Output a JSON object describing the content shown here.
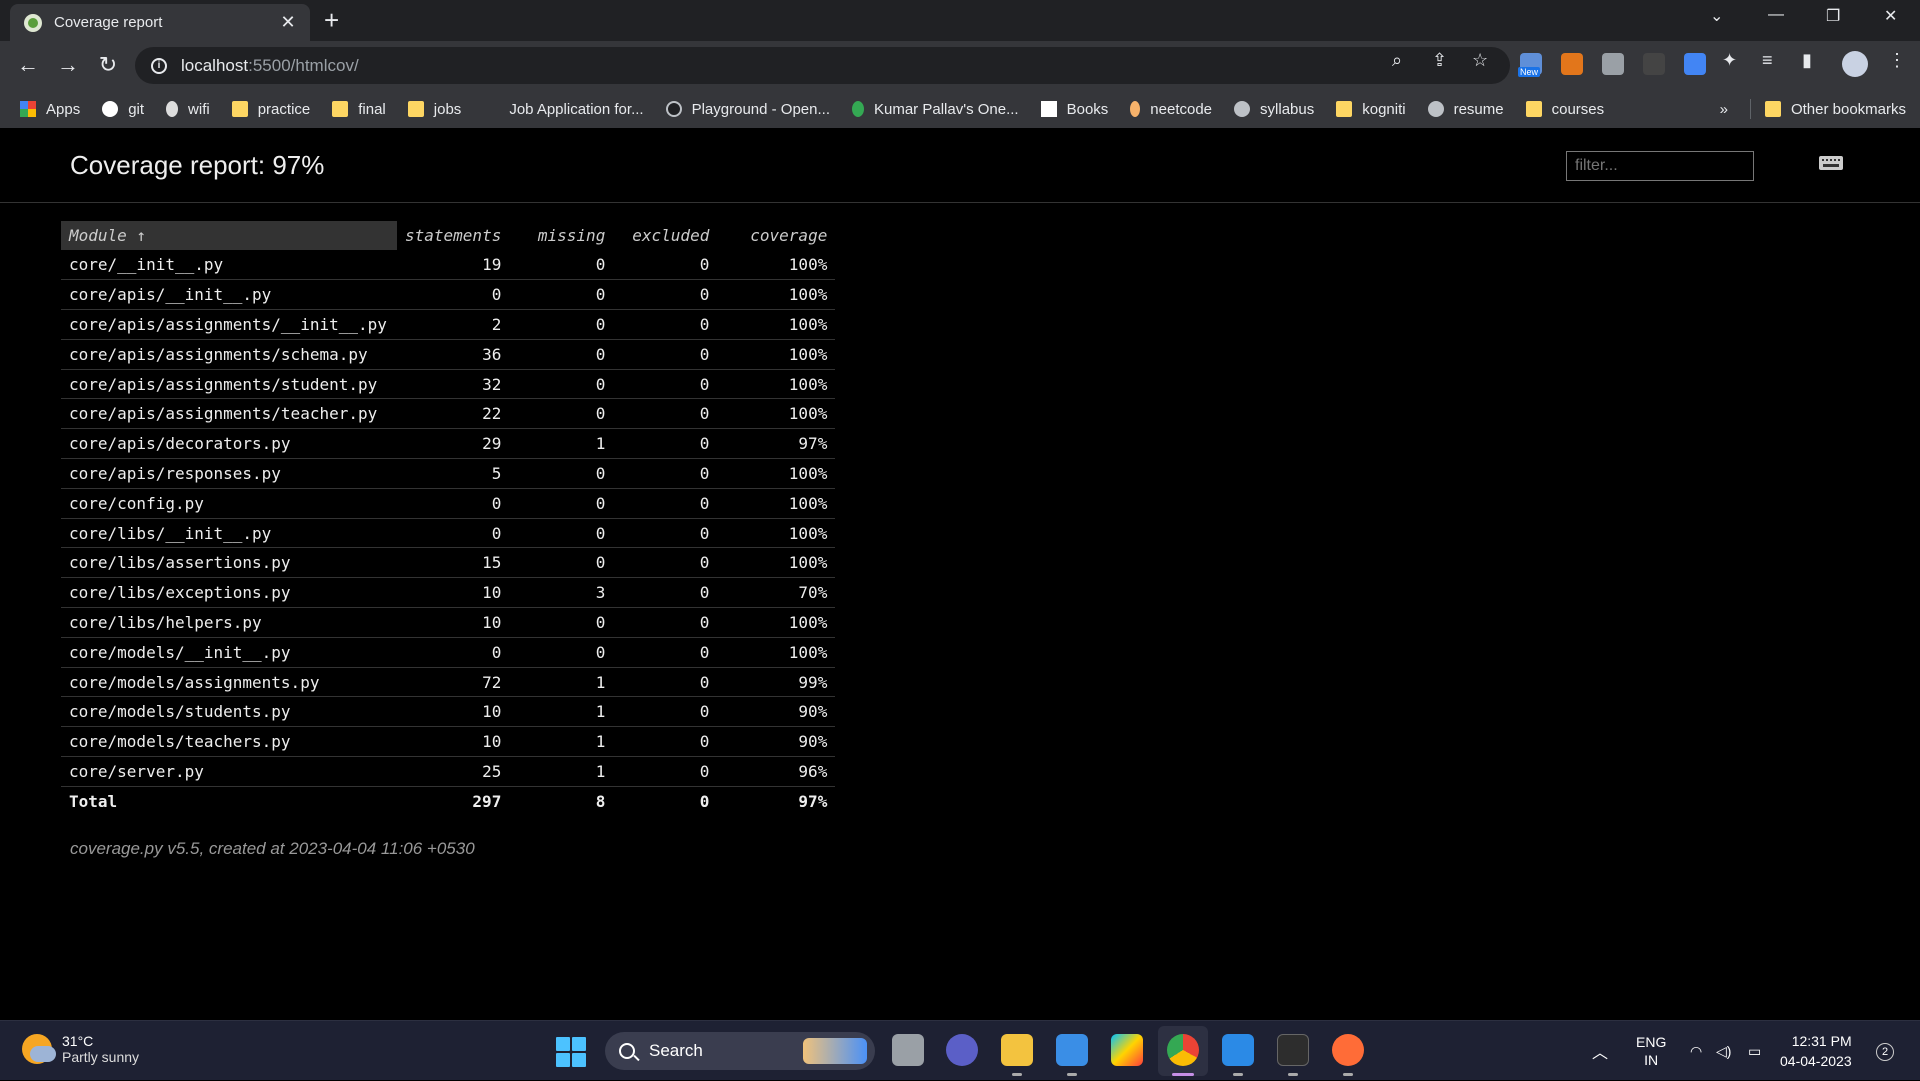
{
  "browser": {
    "tab_title": "Coverage report",
    "url_host": "localhost",
    "url_path": ":5500/htmlcov/",
    "bookmarks": [
      "Apps",
      "git",
      "wifi",
      "practice",
      "final",
      "jobs",
      "Job Application for...",
      "Playground - Open...",
      "Kumar Pallav's One...",
      "Books",
      "neetcode",
      "syllabus",
      "kogniti",
      "resume",
      "courses"
    ],
    "bookmarks_overflow": "»",
    "other_bookmarks": "Other bookmarks",
    "ext_new_badge": "New"
  },
  "report": {
    "title": "Coverage report: 97%",
    "filter_placeholder": "filter...",
    "columns": [
      "Module ↑",
      "statements",
      "missing",
      "excluded",
      "coverage"
    ],
    "rows": [
      [
        "core/__init__.py",
        "19",
        "0",
        "0",
        "100%"
      ],
      [
        "core/apis/__init__.py",
        "0",
        "0",
        "0",
        "100%"
      ],
      [
        "core/apis/assignments/__init__.py",
        "2",
        "0",
        "0",
        "100%"
      ],
      [
        "core/apis/assignments/schema.py",
        "36",
        "0",
        "0",
        "100%"
      ],
      [
        "core/apis/assignments/student.py",
        "32",
        "0",
        "0",
        "100%"
      ],
      [
        "core/apis/assignments/teacher.py",
        "22",
        "0",
        "0",
        "100%"
      ],
      [
        "core/apis/decorators.py",
        "29",
        "1",
        "0",
        "97%"
      ],
      [
        "core/apis/responses.py",
        "5",
        "0",
        "0",
        "100%"
      ],
      [
        "core/config.py",
        "0",
        "0",
        "0",
        "100%"
      ],
      [
        "core/libs/__init__.py",
        "0",
        "0",
        "0",
        "100%"
      ],
      [
        "core/libs/assertions.py",
        "15",
        "0",
        "0",
        "100%"
      ],
      [
        "core/libs/exceptions.py",
        "10",
        "3",
        "0",
        "70%"
      ],
      [
        "core/libs/helpers.py",
        "10",
        "0",
        "0",
        "100%"
      ],
      [
        "core/models/__init__.py",
        "0",
        "0",
        "0",
        "100%"
      ],
      [
        "core/models/assignments.py",
        "72",
        "1",
        "0",
        "99%"
      ],
      [
        "core/models/students.py",
        "10",
        "1",
        "0",
        "90%"
      ],
      [
        "core/models/teachers.py",
        "10",
        "1",
        "0",
        "90%"
      ],
      [
        "core/server.py",
        "25",
        "1",
        "0",
        "96%"
      ]
    ],
    "total": [
      "Total",
      "297",
      "8",
      "0",
      "97%"
    ],
    "footer": "coverage.py v5.5, created at 2023-04-04 11:06 +0530"
  },
  "taskbar": {
    "weather_temp": "31°C",
    "weather_desc": "Partly sunny",
    "search_label": "Search",
    "lang_1": "ENG",
    "lang_2": "IN",
    "time": "12:31 PM",
    "date": "04-04-2023",
    "notifications": "2"
  },
  "colors": {
    "folder": "#fdd663",
    "page_bg": "#000000",
    "header_cell_bg": "#333333"
  }
}
